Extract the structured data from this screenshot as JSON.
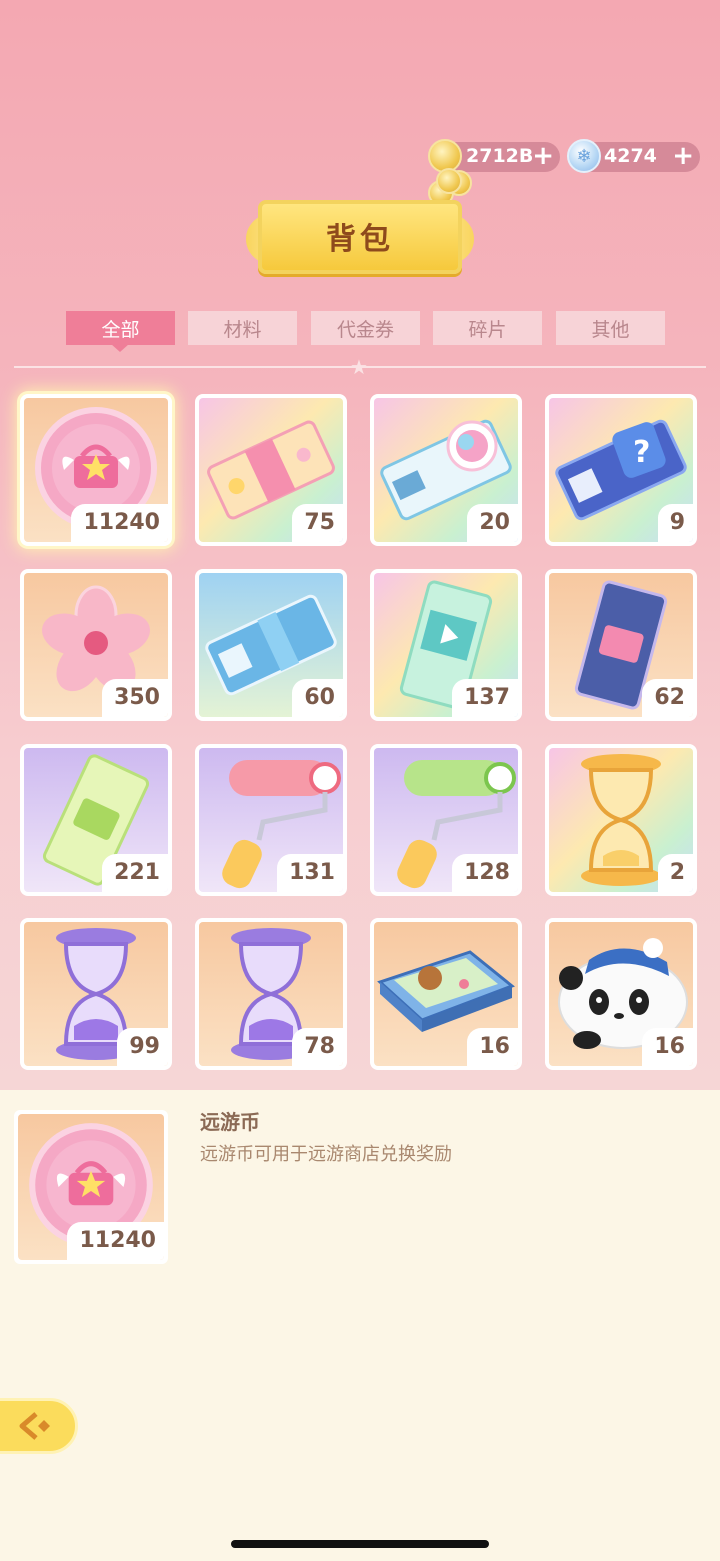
{
  "header": {
    "title": "背包",
    "gold": {
      "value": "2712B",
      "plus": "+"
    },
    "gems": {
      "value": "4274",
      "plus": "+"
    }
  },
  "tabs": [
    {
      "label": "全部",
      "active": true
    },
    {
      "label": "材料",
      "active": false
    },
    {
      "label": "代金券",
      "active": false
    },
    {
      "label": "碎片",
      "active": false
    },
    {
      "label": "其他",
      "active": false
    }
  ],
  "items": [
    {
      "icon": "travel-coin-icon",
      "count": "11240",
      "selected": true
    },
    {
      "icon": "pink-ticket-icon",
      "count": "75"
    },
    {
      "icon": "hair-ticket-icon",
      "count": "20"
    },
    {
      "icon": "mystery-ticket-icon",
      "count": "9"
    },
    {
      "icon": "sakura-flower-icon",
      "count": "350"
    },
    {
      "icon": "blue-ticket-icon",
      "count": "60"
    },
    {
      "icon": "video-ticket-icon",
      "count": "137"
    },
    {
      "icon": "bag-ticket-icon",
      "count": "62"
    },
    {
      "icon": "green-ticket-icon",
      "count": "221"
    },
    {
      "icon": "pink-roller-icon",
      "count": "131"
    },
    {
      "icon": "green-roller-icon",
      "count": "128"
    },
    {
      "icon": "gold-hourglass-icon",
      "count": "2"
    },
    {
      "icon": "purple-hourglass-icon",
      "count": "99"
    },
    {
      "icon": "purple-hourglass-icon",
      "count": "78"
    },
    {
      "icon": "bear-box-icon",
      "count": "16"
    },
    {
      "icon": "panda-plush-icon",
      "count": "16"
    }
  ],
  "detail": {
    "name": "远游币",
    "description": "远游币可用于远游商店兑换奖励",
    "count": "11240",
    "icon": "travel-coin-icon"
  },
  "colors": {
    "background_top": "#f4a8b2",
    "tab_active": "#ef7e98",
    "tab_inactive": "#f7d3d7",
    "panel": "#fcf6e6",
    "gold": "#f6c93c"
  }
}
